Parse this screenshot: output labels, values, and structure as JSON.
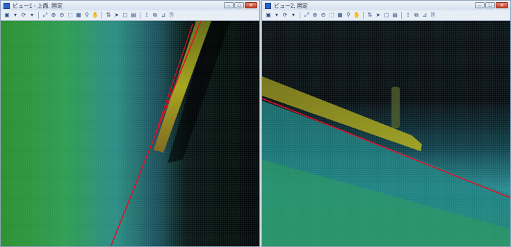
{
  "views": [
    {
      "title": "ビュー1 - 上面, 固定",
      "buttons": {
        "minimize": "–",
        "maximize": "□",
        "close": "✕"
      },
      "toolbar_icons": [
        "view-icon",
        "dropdown-icon",
        "rotate-icon",
        "dropdown-icon",
        "separator",
        "fit-icon",
        "zoom-in-icon",
        "zoom-out-icon",
        "window-icon",
        "grid-icon",
        "walk-icon",
        "pan-icon",
        "separator",
        "bold-icon",
        "arrow-icon",
        "frame-icon",
        "window2-icon",
        "separator",
        "section-icon",
        "clip-icon",
        "measure-icon",
        "save-icon"
      ]
    },
    {
      "title": "ビュー2, 固定",
      "buttons": {
        "minimize": "–",
        "maximize": "□",
        "close": "✕"
      },
      "toolbar_icons": [
        "view-icon",
        "dropdown-icon",
        "rotate-icon",
        "dropdown-icon",
        "separator",
        "fit-icon",
        "zoom-in-icon",
        "zoom-out-icon",
        "window-icon",
        "grid-icon",
        "walk-icon",
        "pan-icon",
        "separator",
        "bold-icon",
        "arrow-icon",
        "frame-icon",
        "window2-icon",
        "separator",
        "section-icon",
        "clip-icon",
        "measure-icon",
        "save-icon"
      ]
    }
  ],
  "colors": {
    "red_line": "#e0102a",
    "ground_green": "#2fa23c",
    "ground_cyan": "#3ab8b0",
    "object_yellow": "#b7b321"
  }
}
